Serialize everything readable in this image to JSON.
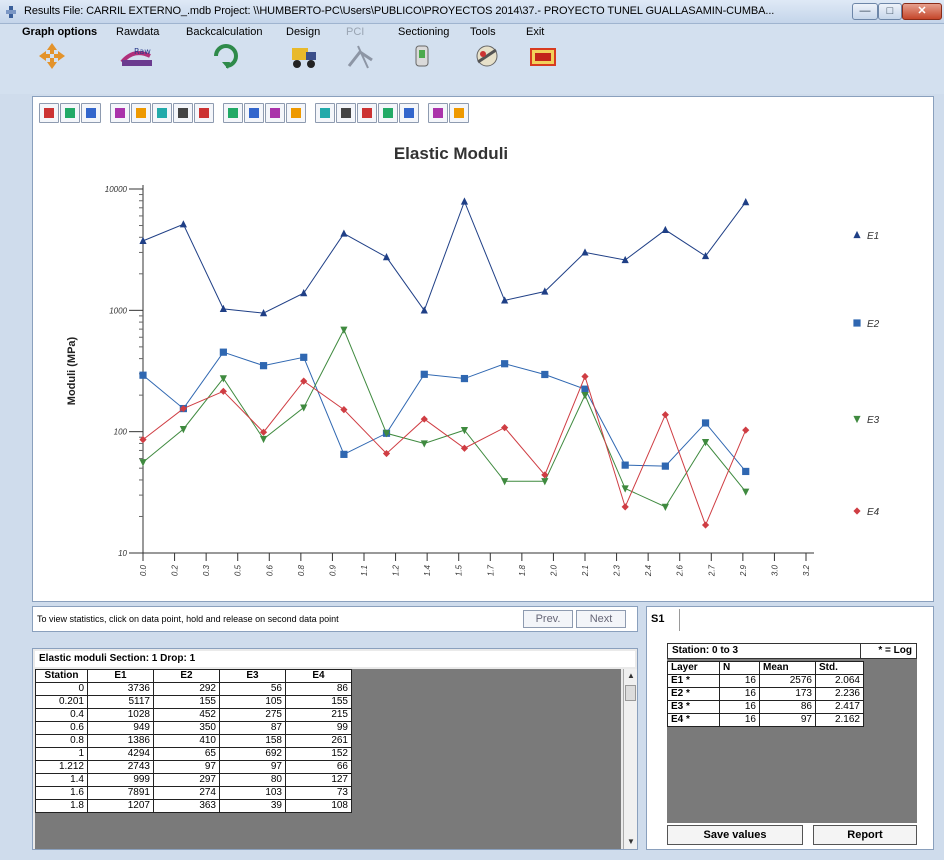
{
  "window": {
    "title": "Results   File: CARRIL EXTERNO_.mdb   Project: \\\\HUMBERTO-PC\\Users\\PUBLICO\\PROYECTOS 2014\\37.- PROYECTO TUNEL GUALLASAMIN-CUMBA..."
  },
  "menu": [
    {
      "label": "Graph options",
      "icon": "arrows-icon"
    },
    {
      "label": "Rawdata",
      "icon": "rawdata-icon"
    },
    {
      "label": "Backcalculation",
      "icon": "backcalc-icon"
    },
    {
      "label": "Design",
      "icon": "truck-icon"
    },
    {
      "label": "PCI",
      "icon": "pci-icon"
    },
    {
      "label": "Sectioning",
      "icon": "sectioning-icon"
    },
    {
      "label": "Tools",
      "icon": "tools-icon"
    },
    {
      "label": "Exit",
      "icon": "exit-icon"
    }
  ],
  "colors": {
    "E1": "#1f3f86",
    "E2": "#2f67b1",
    "E3": "#3f8a3f",
    "E4": "#cf3d43"
  },
  "chart_data": {
    "type": "line",
    "title": "Elastic Moduli",
    "xlabel": "",
    "ylabel": "Moduli (MPa)",
    "yscale": "log",
    "ylim": [
      10,
      10000
    ],
    "xlim": [
      0,
      3.3
    ],
    "yticks": [
      "10",
      "100",
      "1000",
      "10000"
    ],
    "xticks": [
      "0.0",
      "0.2",
      "0.3",
      "0.5",
      "0.6",
      "0.8",
      "0.9",
      "1.1",
      "1.2",
      "1.4",
      "1.5",
      "1.7",
      "1.8",
      "2.0",
      "2.1",
      "2.3",
      "2.4",
      "2.6",
      "2.7",
      "2.9",
      "3.0",
      "3.2"
    ],
    "x": [
      0,
      0.201,
      0.4,
      0.6,
      0.8,
      1.0,
      1.212,
      1.4,
      1.6,
      1.8,
      2.0,
      2.2,
      2.4,
      2.6,
      2.8,
      3.0
    ],
    "legend_position": "right",
    "series": [
      {
        "name": "E1",
        "marker": "triangle-up",
        "values": [
          3736,
          5117,
          1028,
          949,
          1386,
          4294,
          2743,
          999,
          7891,
          1207,
          1430,
          3000,
          2600,
          4600,
          2800,
          7800
        ]
      },
      {
        "name": "E2",
        "marker": "square",
        "values": [
          292,
          155,
          452,
          350,
          410,
          65,
          97,
          297,
          274,
          363,
          296,
          224,
          53,
          52,
          118,
          47
        ]
      },
      {
        "name": "E3",
        "marker": "triangle-down",
        "values": [
          56,
          105,
          275,
          87,
          158,
          692,
          97,
          80,
          103,
          39,
          39,
          200,
          34,
          24,
          82,
          32
        ]
      },
      {
        "name": "E4",
        "marker": "diamond",
        "values": [
          86,
          155,
          215,
          99,
          261,
          152,
          66,
          127,
          73,
          108,
          44,
          285,
          24,
          138,
          17,
          103
        ]
      }
    ]
  },
  "status": {
    "message": "To view statistics, click on data point, hold and release on second data point",
    "prev_label": "Prev.",
    "next_label": "Next"
  },
  "datagrid": {
    "header": "Elastic moduli   Section: 1   Drop: 1",
    "columns": [
      "Station",
      "E1",
      "E2",
      "E3",
      "E4"
    ],
    "rows": [
      [
        "0",
        "3736",
        "292",
        "56",
        "86"
      ],
      [
        "0.201",
        "5117",
        "155",
        "105",
        "155"
      ],
      [
        "0.4",
        "1028",
        "452",
        "275",
        "215"
      ],
      [
        "0.6",
        "949",
        "350",
        "87",
        "99"
      ],
      [
        "0.8",
        "1386",
        "410",
        "158",
        "261"
      ],
      [
        "1",
        "4294",
        "65",
        "692",
        "152"
      ],
      [
        "1.212",
        "2743",
        "97",
        "97",
        "66"
      ],
      [
        "1.4",
        "999",
        "297",
        "80",
        "127"
      ],
      [
        "1.6",
        "7891",
        "274",
        "103",
        "73"
      ],
      [
        "1.8",
        "1207",
        "363",
        "39",
        "108"
      ]
    ]
  },
  "stats": {
    "tab": "S1",
    "station_label": "Station: 0 to 3",
    "log_note": "* = Log",
    "columns": [
      "Layer",
      "N",
      "Mean",
      "Std."
    ],
    "rows": [
      [
        "E1 *",
        "16",
        "2576",
        "2.064"
      ],
      [
        "E2 *",
        "16",
        "173",
        "2.236"
      ],
      [
        "E3 *",
        "16",
        "86",
        "2.417"
      ],
      [
        "E4 *",
        "16",
        "97",
        "2.162"
      ]
    ],
    "save_label": "Save values",
    "report_label": "Report"
  },
  "toolbar_icons": [
    "bar-chart-icon",
    "3d-chart-icon",
    "area-chart-icon",
    "table-icon",
    "label-icon",
    "series-icon",
    "grid-icon",
    "zoom-icon",
    "fill-icon",
    "scatter-icon",
    "stack-icon",
    "plus-icon",
    "color-icon",
    "list-icon",
    "legend-icon",
    "print-icon",
    "pen-icon",
    "help-icon",
    "search-icon"
  ]
}
